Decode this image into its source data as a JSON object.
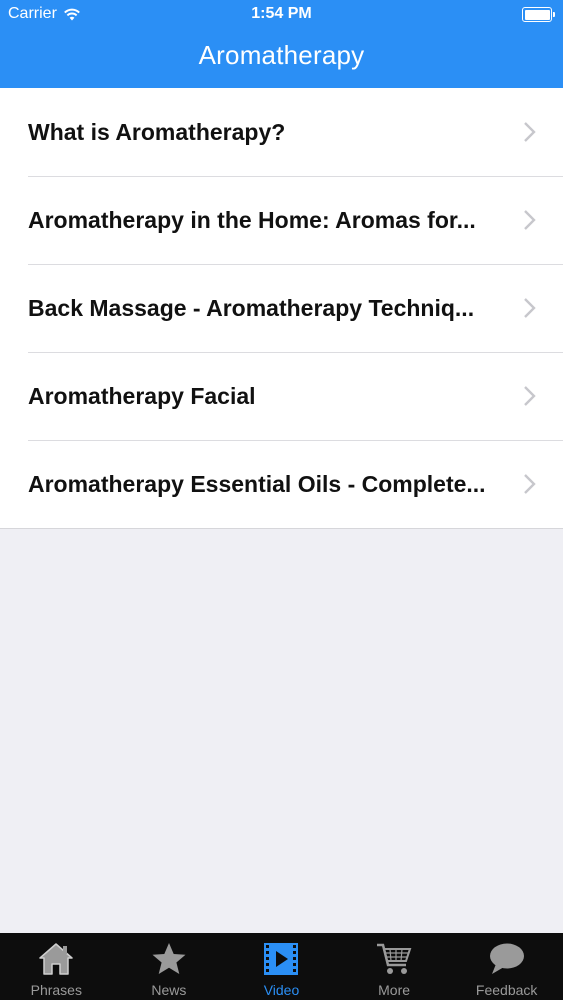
{
  "status_bar": {
    "carrier": "Carrier",
    "time": "1:54 PM"
  },
  "nav": {
    "title": "Aromatherapy"
  },
  "list": {
    "items": [
      {
        "label": "What is Aromatherapy?"
      },
      {
        "label": "Aromatherapy in the Home: Aromas for..."
      },
      {
        "label": "Back Massage - Aromatherapy Techniq..."
      },
      {
        "label": "Aromatherapy Facial"
      },
      {
        "label": "Aromatherapy Essential Oils - Complete..."
      }
    ]
  },
  "tabbar": {
    "tabs": [
      {
        "label": "Phrases",
        "icon": "home-icon"
      },
      {
        "label": "News",
        "icon": "star-icon"
      },
      {
        "label": "Video",
        "icon": "film-icon",
        "active": true
      },
      {
        "label": "More",
        "icon": "cart-icon"
      },
      {
        "label": "Feedback",
        "icon": "speech-bubble-icon"
      }
    ]
  },
  "colors": {
    "accent": "#2b8ff5",
    "tabbar_bg": "#0d0d0d",
    "background": "#efeff4"
  }
}
